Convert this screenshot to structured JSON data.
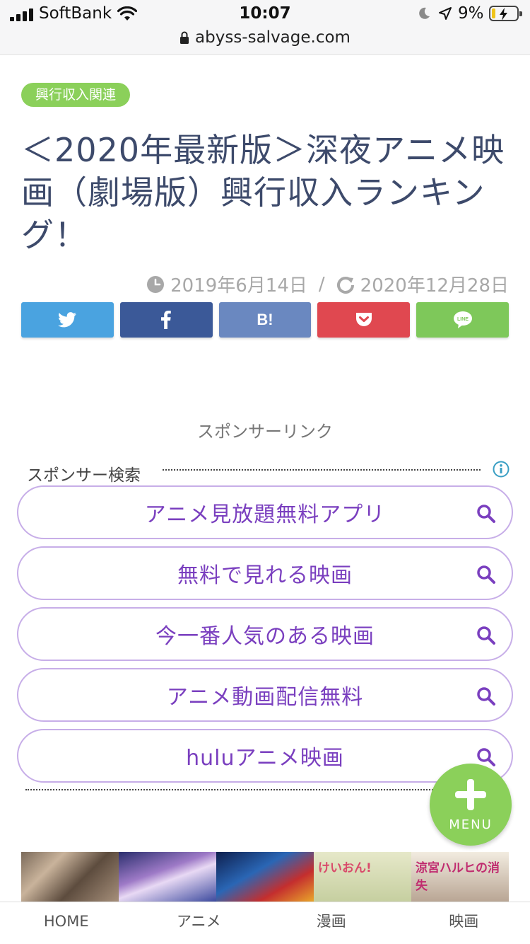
{
  "status_bar": {
    "carrier": "SoftBank",
    "time": "10:07",
    "battery_percent": "9%",
    "battery_level": 0.09,
    "url": "abyss-salvage.com"
  },
  "article": {
    "category": "興行収入関連",
    "title": "＜2020年最新版＞深夜アニメ映画（劇場版）興行収入ランキング！",
    "published": "2019年6月14日",
    "date_separator": "/",
    "updated": "2020年12月28日"
  },
  "share": {
    "twitter_icon": "twitter-icon",
    "facebook_icon": "facebook-icon",
    "hatena_label": "B!",
    "pocket_icon": "pocket-icon",
    "line_label": "LINE",
    "colors": {
      "twitter": "#4aa3e0",
      "facebook": "#3b5998",
      "hatena": "#6a88c0",
      "pocket": "#e04850",
      "line": "#7ec85a"
    }
  },
  "sponsor": {
    "label": "スポンサーリンク",
    "search_title": "スポンサー検索",
    "queries": [
      "アニメ見放題無料アプリ",
      "無料で見れる映画",
      "今一番人気のある映画",
      "アニメ動画配信無料",
      "huluアニメ映画"
    ]
  },
  "fab": {
    "label": "MENU",
    "color": "#8bd05a"
  },
  "banner": {
    "slide4_text": "けいおん!",
    "slide5_text": "涼宮ハルヒの消失"
  },
  "tabbar": {
    "items": [
      "HOME",
      "アニメ",
      "漫画",
      "映画"
    ]
  }
}
